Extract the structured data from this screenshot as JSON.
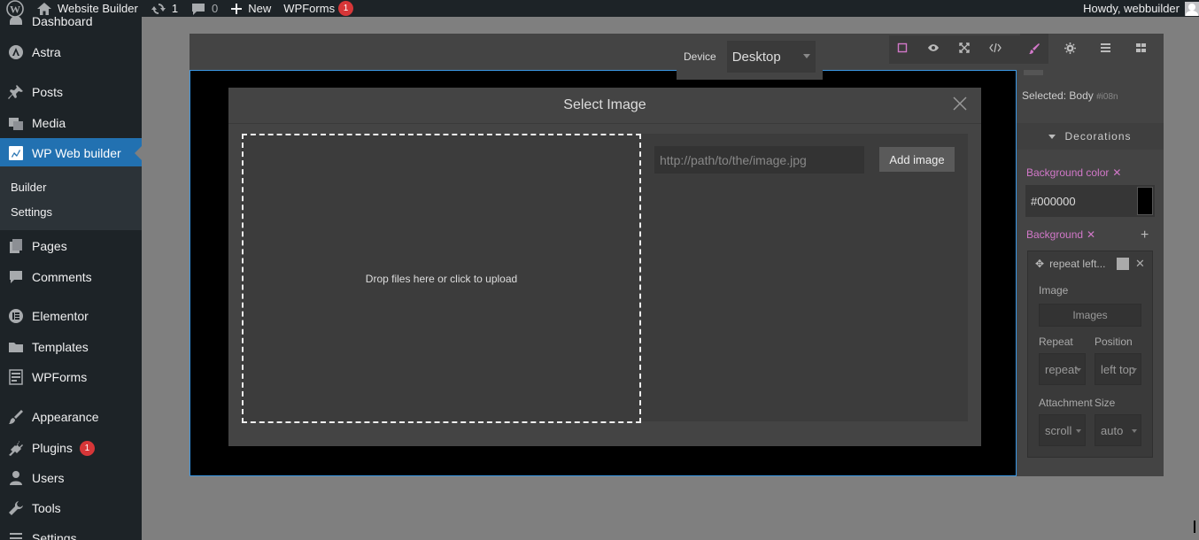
{
  "adminbar": {
    "site_name": "Website Builder",
    "updates_count": "1",
    "comments_count": "0",
    "new_label": "New",
    "wpforms_label": "WPForms",
    "wpforms_badge": "1",
    "howdy": "Howdy, webbuilder"
  },
  "menu": {
    "dashboard": "Dashboard",
    "astra": "Astra",
    "posts": "Posts",
    "media": "Media",
    "wp_web_builder": "WP Web builder",
    "builder": "Builder",
    "settings_sub": "Settings",
    "pages": "Pages",
    "comments": "Comments",
    "elementor": "Elementor",
    "templates": "Templates",
    "wpforms": "WPForms",
    "appearance": "Appearance",
    "plugins": "Plugins",
    "plugins_badge": "1",
    "users": "Users",
    "tools": "Tools",
    "settings": "Settings"
  },
  "editor": {
    "device_label": "Device",
    "device_value": "Desktop",
    "toolbar": {
      "sw_visibility_icon": "square-outline-icon",
      "preview_icon": "eye-icon",
      "fullscreen_icon": "expand-icon",
      "code_icon": "code-icon",
      "style_manager_icon": "paint-brush-icon",
      "settings_icon": "gear-icon",
      "layers_icon": "bars-icon",
      "blocks_icon": "grid-icon"
    }
  },
  "panel": {
    "selected_prefix": "Selected:",
    "selected_name": "Body",
    "selected_id": "#i08n",
    "sector_title": "Decorations",
    "bg_color_label": "Background color",
    "bg_color_value": "#000000",
    "background_label": "Background",
    "layer": {
      "name": "repeat left...",
      "image_label": "Image",
      "images_button": "Images",
      "repeat_label": "Repeat",
      "repeat_value": "repeat",
      "position_label": "Position",
      "position_value": "left top",
      "attachment_label": "Attachment",
      "attachment_value": "scroll",
      "size_label": "Size",
      "size_value": "auto"
    }
  },
  "modal": {
    "title": "Select Image",
    "dropzone_text": "Drop files here or click to upload",
    "url_placeholder": "http://path/to/the/image.jpg",
    "add_button": "Add image"
  },
  "colors": {
    "admin_bar": "#1d2327",
    "accent": "#2271b1",
    "badge": "#d63638",
    "editor_bg": "#444444",
    "pink_label": "#d278c9"
  }
}
